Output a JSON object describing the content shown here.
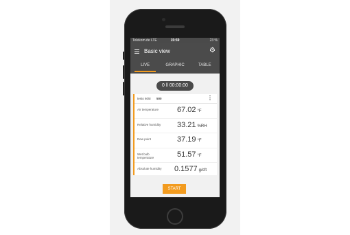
{
  "status_bar": {
    "carrier": "Telekom.de  LTE",
    "time": "15:59",
    "battery": "23 %"
  },
  "app_bar": {
    "title": "Basic view"
  },
  "tabs": [
    {
      "label": "LIVE",
      "active": true
    },
    {
      "label": "GRAPHIC",
      "active": false
    },
    {
      "label": "TABLE",
      "active": false
    }
  ],
  "timer": "0 ‖ 00:00:00",
  "card": {
    "device": "testo 605i",
    "serial": "500",
    "rows": [
      {
        "label": "Air temperature",
        "value": "67.02",
        "unit": "°F"
      },
      {
        "label": "Relative humidity",
        "value": "33.21",
        "unit": "%RH"
      },
      {
        "label": "Dew point",
        "value": "37.19",
        "unit": "°F"
      },
      {
        "label": "Wet bulb temperature",
        "value": "51.57",
        "unit": "°F"
      },
      {
        "label": "Absolute humidity",
        "value": "0.1577",
        "unit": "g/cft"
      }
    ]
  },
  "start_label": "START",
  "colors": {
    "accent": "#f29b1f",
    "header": "#4b4b4b"
  }
}
